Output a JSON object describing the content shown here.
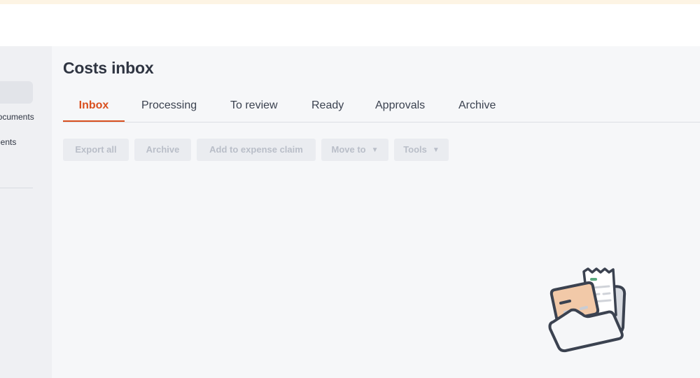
{
  "sidebar": {
    "items": [
      {
        "label": "Documents"
      },
      {
        "label": "Payments"
      }
    ]
  },
  "main": {
    "title": "Costs inbox",
    "tabs": [
      {
        "label": "Inbox",
        "active": true
      },
      {
        "label": "Processing",
        "active": false
      },
      {
        "label": "To review",
        "active": false
      },
      {
        "label": "Ready",
        "active": false
      },
      {
        "label": "Approvals",
        "active": false
      },
      {
        "label": "Archive",
        "active": false
      }
    ],
    "toolbar": {
      "export_all": "Export all",
      "archive": "Archive",
      "add_to_expense_claim": "Add to expense claim",
      "move_to": "Move to",
      "tools": "Tools"
    }
  },
  "colors": {
    "accent": "#d9501f",
    "banner": "#fdf4e4",
    "sidebar_bg": "#eff0f3",
    "main_bg": "#f6f7f9",
    "disabled_text": "#b9bec8"
  },
  "icons": {
    "dropdown": "caret-down-icon",
    "empty_state": "receipt-folder-illustration"
  }
}
